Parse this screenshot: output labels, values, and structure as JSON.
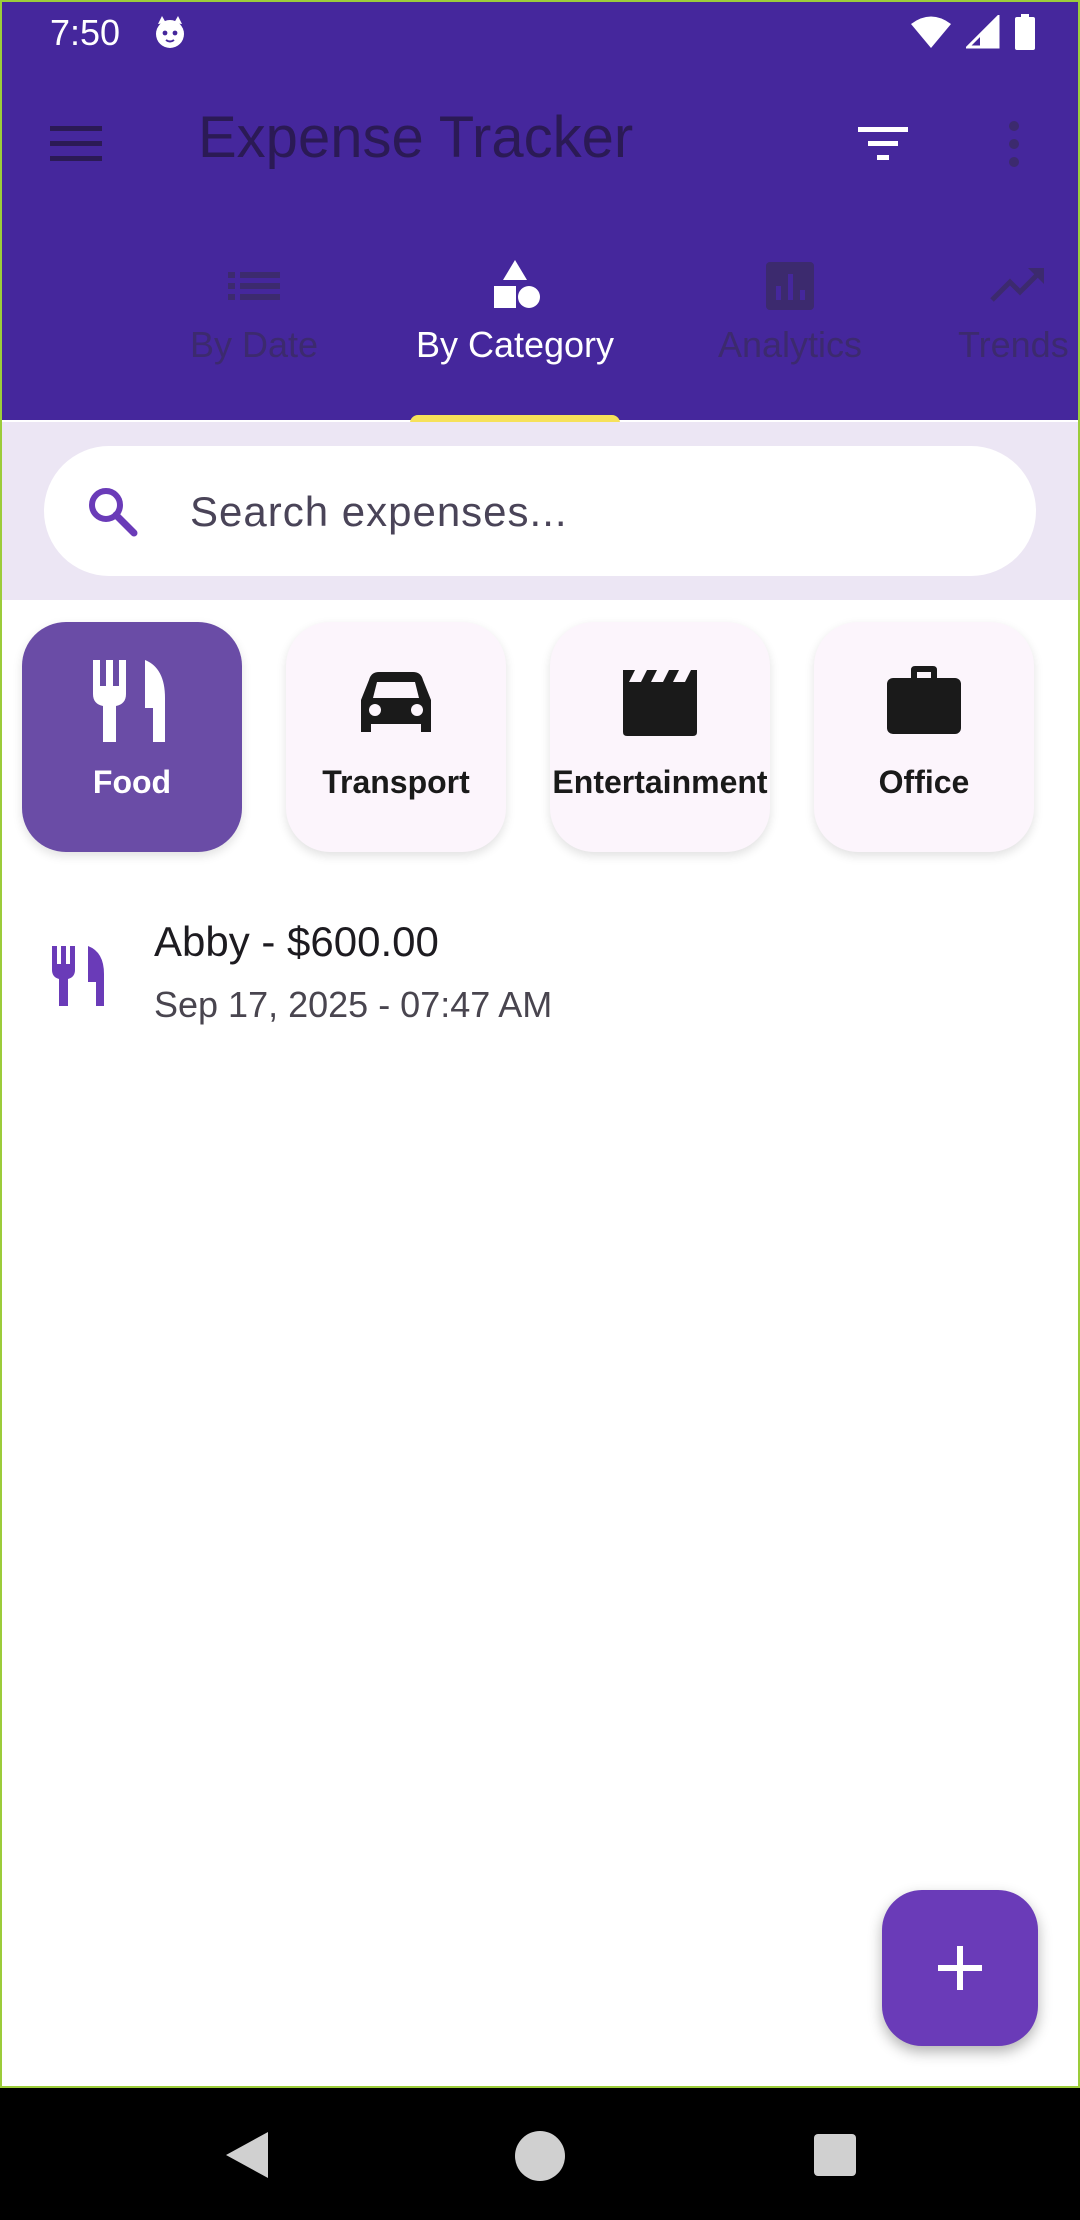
{
  "status_bar": {
    "time": "7:50",
    "icons": [
      "cat-icon",
      "wifi-icon",
      "signal-icon",
      "battery-icon"
    ]
  },
  "app_bar": {
    "title": "Expense Tracker",
    "menu_icon": "menu-icon",
    "filter_icon": "filter-icon",
    "more_icon": "more-vert-icon"
  },
  "tabs": [
    {
      "label": "By Date",
      "icon": "list-icon",
      "active": false
    },
    {
      "label": "By Category",
      "icon": "category-icon",
      "active": true
    },
    {
      "label": "Analytics",
      "icon": "analytics-icon",
      "active": false
    },
    {
      "label": "Trends",
      "icon": "trending-up-icon",
      "active": false
    }
  ],
  "search": {
    "placeholder": "Search expenses...",
    "value": ""
  },
  "categories": [
    {
      "label": "Food",
      "icon": "fork-knife-icon",
      "selected": true
    },
    {
      "label": "Transport",
      "icon": "car-icon",
      "selected": false
    },
    {
      "label": "Entertainment",
      "icon": "clapperboard-icon",
      "selected": false
    },
    {
      "label": "Office",
      "icon": "briefcase-icon",
      "selected": false
    }
  ],
  "expenses": [
    {
      "title": "Abby - $600.00",
      "subtitle": "Sep 17, 2025 - 07:47 AM",
      "icon": "fork-knife-icon"
    }
  ],
  "fab": {
    "icon": "plus-icon"
  },
  "colors": {
    "primary": "#45279c",
    "accent": "#6a4ca6",
    "fab": "#6a3bb8",
    "indicator": "#f6e15a",
    "search_bg": "#ece6f4"
  }
}
